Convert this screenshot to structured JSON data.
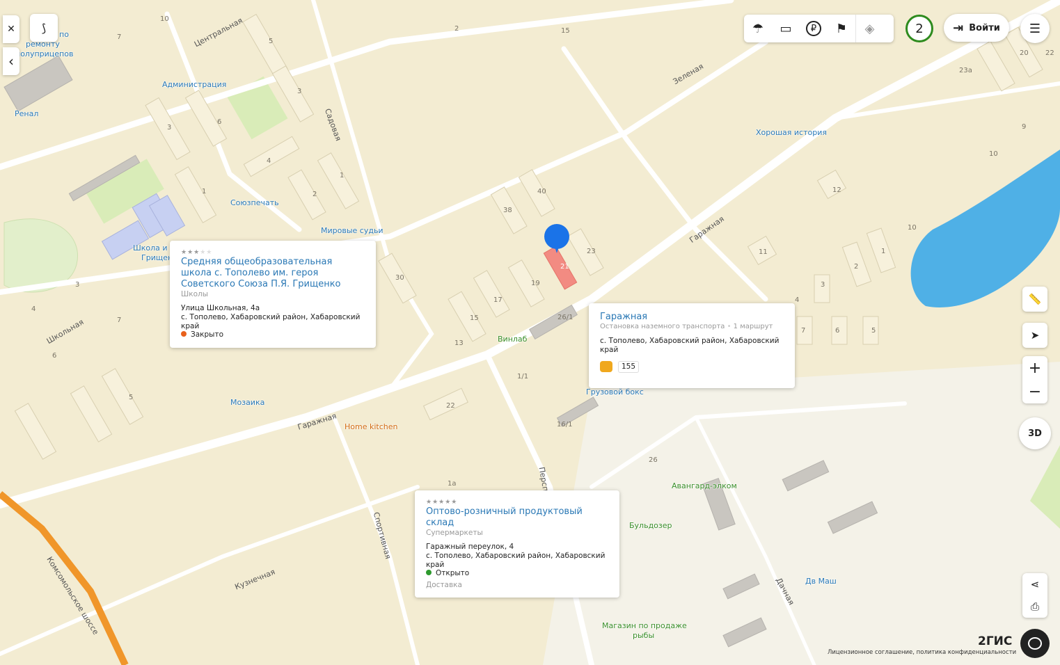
{
  "toolbar": {
    "login_label": "Войти",
    "badge_count": "2"
  },
  "left_controls": {
    "close": "✕",
    "back": "‹"
  },
  "right_controls": {
    "zoom_in": "+",
    "zoom_out": "−",
    "three_d": "3D"
  },
  "map": {
    "labels": [
      "по",
      "ремонту",
      "полуприцепов",
      "Ренал",
      "Администрация",
      "Центральная",
      "Садовая",
      "Союзпечать",
      "Мировые судьи",
      "Школа и",
      "Грищенко",
      "Школьная",
      "Мозаика",
      "Гаражная",
      "Home kitchen",
      "Винлаб",
      "Грузовой бокс",
      "Зеленая",
      "Гаражная",
      "Хорошая история",
      "Авангард-элком",
      "Бульдозер",
      "Дв Маш",
      "Магазин по продаже",
      "рыбы",
      "Спортивная",
      "Кузнечная",
      "Комсомольское шоссе",
      "Дачная",
      "Перспе"
    ],
    "house_numbers": [
      "10",
      "7",
      "5",
      "3",
      "6",
      "4",
      "1",
      "2",
      "1",
      "3",
      "40",
      "38",
      "23",
      "21",
      "19",
      "17",
      "15",
      "30",
      "26/1",
      "1/1",
      "16/1",
      "22",
      "1а",
      "13",
      "4",
      "3",
      "5",
      "7",
      "6",
      "12",
      "11",
      "10",
      "1",
      "2",
      "3",
      "4",
      "7",
      "6",
      "5",
      "20",
      "22",
      "23а",
      "9",
      "10",
      "26",
      "15",
      "2"
    ]
  },
  "popups": [
    {
      "stars": "★★★",
      "stars_empty": "★★",
      "title": "Средняя общеобразовательная школа с. Тополево им. героя Советского Союза П.Я. Грищенко",
      "category": "Школы",
      "address1": "Улица Школьная, 4а",
      "address2": "с. Тополево, Хабаровский район, Хабаровский край",
      "status": "Закрыто",
      "status_color": "#e8601c"
    },
    {
      "title": "Гаражная",
      "category": "Остановка наземного транспорта",
      "routes": "1 маршрут",
      "address2": "с. Тополево, Хабаровский район, Хабаровский край",
      "route_number": "155"
    },
    {
      "stars": "★★★★★",
      "title": "Оптово-розничный продуктовый склад",
      "category": "Супермаркеты",
      "address1": "Гаражный переулок, 4",
      "address2": "с. Тополево, Хабаровский район, Хабаровский край",
      "status": "Открыто",
      "status_color": "#2e9a2e",
      "extra": "Доставка"
    }
  ],
  "footer": {
    "logo": "2ГИС",
    "legal": "Лицензионное соглашение, политика конфиденциальности"
  },
  "colors": {
    "map_bg": "#f3ecd2",
    "road": "#ffffff",
    "water": "#4fb0e6",
    "highway": "#f0962a",
    "link": "#2a78b5",
    "marker": "#1a73e8",
    "selected_building": "#f28b82"
  }
}
